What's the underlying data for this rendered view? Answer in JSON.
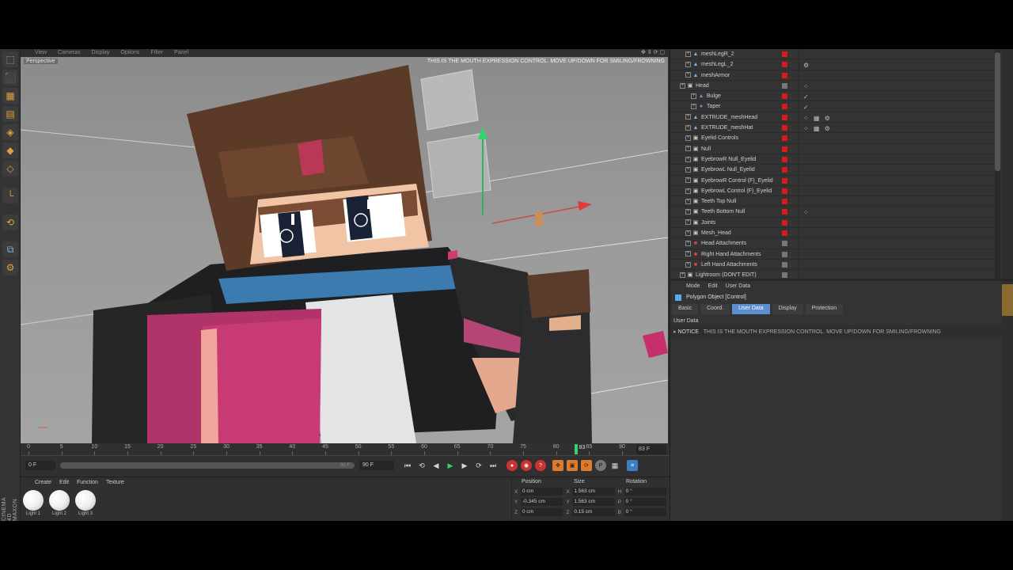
{
  "viewport": {
    "menu": [
      "View",
      "Cameras",
      "Display",
      "Options",
      "Filter",
      "Panel"
    ],
    "label": "Perspective",
    "notice": "THIS IS THE MOUTH EXPRESSION CONTROL. MOVE UP/DOWN FOR SMILING/FROWNING"
  },
  "timeline": {
    "ticks": [
      "0",
      "5",
      "10",
      "15",
      "20",
      "25",
      "30",
      "35",
      "40",
      "45",
      "50",
      "55",
      "60",
      "65",
      "70",
      "75",
      "80",
      "85",
      "90"
    ],
    "playhead_frame": 83,
    "playhead_readout": "83",
    "frame_readout": "83 F",
    "start_field": "0 F",
    "range_end_label": "90 F",
    "end_field": "90 F"
  },
  "materials": {
    "menu": [
      "Create",
      "Edit",
      "Function",
      "Texture"
    ],
    "items": [
      "Light 1",
      "Light 2",
      "Light 3"
    ],
    "brand": "CINEMA 4D MAXON"
  },
  "coordinates": {
    "headers": [
      "Position",
      "Size",
      "Rotation"
    ],
    "rows": [
      {
        "a1": "X",
        "v1": "0 cm",
        "a2": "X",
        "v2": "1.563 cm",
        "a3": "H",
        "v3": "0 °"
      },
      {
        "a1": "Y",
        "v1": "-0.345 cm",
        "a2": "Y",
        "v2": "1.563 cm",
        "a3": "P",
        "v3": "0 °"
      },
      {
        "a1": "Z",
        "v1": "0 cm",
        "a2": "Z",
        "v2": "0.15 cm",
        "a3": "B",
        "v3": "0 °"
      }
    ]
  },
  "objects": [
    {
      "name": "meshLegR_2",
      "indent": 1,
      "icon": "▲",
      "color": "#7fb2e0",
      "vis": "red",
      "tags": ""
    },
    {
      "name": "meshLegL_2",
      "indent": 1,
      "icon": "▲",
      "color": "#7fb2e0",
      "vis": "red",
      "tags": "⚙"
    },
    {
      "name": "meshArmor",
      "indent": 1,
      "icon": "▲",
      "color": "#7fb2e0",
      "vis": "red",
      "tags": ""
    },
    {
      "name": "Head",
      "indent": 0,
      "icon": "▣",
      "color": "#cfcfcf",
      "vis": "gray",
      "tags": "⁘"
    },
    {
      "name": "Bulge",
      "indent": 2,
      "icon": "▲",
      "color": "#8d7fe0",
      "vis": "red",
      "tags": "✓"
    },
    {
      "name": "Taper",
      "indent": 2,
      "icon": "●",
      "color": "#8d7fe0",
      "vis": "red",
      "tags": "✓"
    },
    {
      "name": "EXTRUDE_meshHead",
      "indent": 1,
      "icon": "▲",
      "color": "#7fb2e0",
      "vis": "red",
      "tags": "⁘ ▦ ⚙"
    },
    {
      "name": "EXTRUDE_meshHat",
      "indent": 1,
      "icon": "▲",
      "color": "#7fb2e0",
      "vis": "red",
      "tags": "⁘ ▦ ⚙"
    },
    {
      "name": "Eyelid Controls",
      "indent": 1,
      "icon": "▣",
      "color": "#cfcfcf",
      "vis": "red",
      "tags": ""
    },
    {
      "name": "Null",
      "indent": 1,
      "icon": "▣",
      "color": "#cfcfcf",
      "vis": "red",
      "tags": ""
    },
    {
      "name": "EyebrowR Null_Eyelid",
      "indent": 1,
      "icon": "▣",
      "color": "#cfcfcf",
      "vis": "red",
      "tags": ""
    },
    {
      "name": "EyebrowL Null_Eyelid",
      "indent": 1,
      "icon": "▣",
      "color": "#cfcfcf",
      "vis": "red",
      "tags": ""
    },
    {
      "name": "EyebrowR Control (F)_Eyelid",
      "indent": 1,
      "icon": "▣",
      "color": "#cfcfcf",
      "vis": "red",
      "tags": ""
    },
    {
      "name": "EyebrowL Control (F)_Eyelid",
      "indent": 1,
      "icon": "▣",
      "color": "#cfcfcf",
      "vis": "red",
      "tags": ""
    },
    {
      "name": "Teeth Top Null",
      "indent": 1,
      "icon": "▣",
      "color": "#cfcfcf",
      "vis": "red",
      "tags": ""
    },
    {
      "name": "Teeth Bottom Null",
      "indent": 1,
      "icon": "▣",
      "color": "#cfcfcf",
      "vis": "red",
      "tags": "⁘"
    },
    {
      "name": "Joints",
      "indent": 1,
      "icon": "▣",
      "color": "#cfcfcf",
      "vis": "red",
      "tags": ""
    },
    {
      "name": "Mesh_Head",
      "indent": 1,
      "icon": "▣",
      "color": "#cfcfcf",
      "vis": "red",
      "tags": ""
    },
    {
      "name": "Head Attachments",
      "indent": 1,
      "icon": "■",
      "color": "#d44",
      "vis": "gray",
      "tags": ""
    },
    {
      "name": "Right Hand Attachments",
      "indent": 1,
      "icon": "■",
      "color": "#d44",
      "vis": "gray",
      "tags": ""
    },
    {
      "name": "Left Hand Attachments",
      "indent": 1,
      "icon": "■",
      "color": "#d44",
      "vis": "gray",
      "tags": ""
    },
    {
      "name": "Lightroom (DON'T EDIT)",
      "indent": 0,
      "icon": "▣",
      "color": "#cfcfcf",
      "vis": "gray",
      "tags": ""
    }
  ],
  "attributes": {
    "menu": [
      "Mode",
      "Edit",
      "User Data"
    ],
    "title": "Polygon Object [Control]",
    "tabs": [
      "Basic",
      "Coord.",
      "User Data",
      "Display",
      "Protection"
    ],
    "active_tab": "User Data",
    "section": "User Data",
    "notice_label": "NOTICE",
    "notice_text": "THIS IS THE MOUTH EXPRESSION CONTROL. MOVE UP/DOWN FOR SMILING/FROWNING"
  },
  "colors": {
    "accent": "#5b8fd0",
    "play": "#39d26a",
    "record": "#c83333",
    "visibility_red": "#d81c1c"
  }
}
